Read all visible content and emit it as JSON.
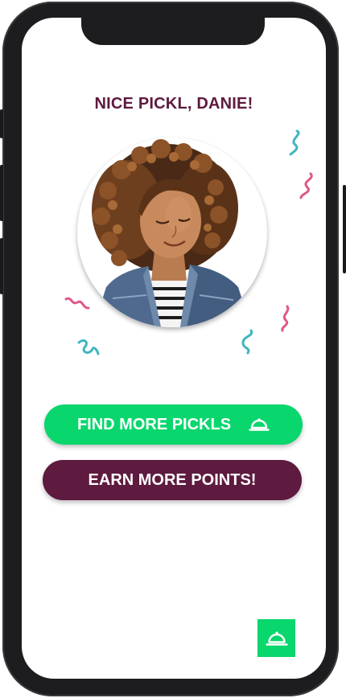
{
  "screen": {
    "title": "NICE PICKL, DANIE!"
  },
  "buttons": {
    "find_label": "FIND MORE PICKLS",
    "earn_label": "EARN MORE POINTS!"
  },
  "icons": {
    "find_icon": "cloche-icon",
    "fab_icon": "cloche-icon"
  },
  "colors": {
    "title": "#5e1a3f",
    "primary_green": "#09d66d",
    "primary_maroon": "#5e1a3f",
    "confetti_teal": "#3fb6c0",
    "confetti_pink": "#e0578b"
  }
}
